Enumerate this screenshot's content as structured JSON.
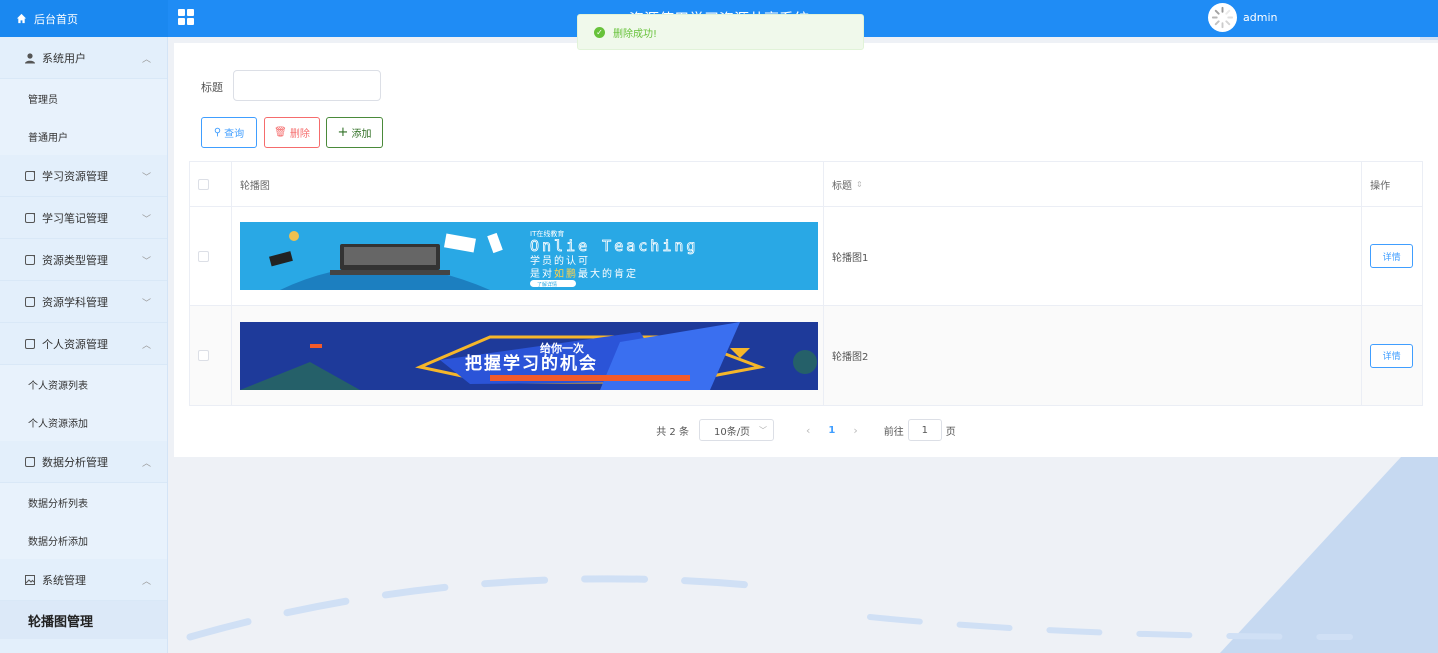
{
  "header": {
    "brand_label": "后台首页",
    "system_title": "资源使用学习资源共享系统",
    "username": "admin"
  },
  "toast": {
    "message": "删除成功!"
  },
  "sidebar": {
    "groups": [
      {
        "label": "系统用户",
        "arrow": "^",
        "icon": "user-icon",
        "items": [
          {
            "label": "管理员"
          },
          {
            "label": "普通用户"
          }
        ]
      },
      {
        "label": "学习资源管理",
        "arrow": "v",
        "icon": "menu-icon"
      },
      {
        "label": "学习笔记管理",
        "arrow": "v",
        "icon": "menu-icon"
      },
      {
        "label": "资源类型管理",
        "arrow": "v",
        "icon": "menu-icon"
      },
      {
        "label": "资源学科管理",
        "arrow": "v",
        "icon": "menu-icon"
      },
      {
        "label": "个人资源管理",
        "arrow": "^",
        "icon": "menu-icon",
        "items": [
          {
            "label": "个人资源列表"
          },
          {
            "label": "个人资源添加"
          }
        ]
      },
      {
        "label": "数据分析管理",
        "arrow": "^",
        "icon": "menu-icon",
        "items": [
          {
            "label": "数据分析列表"
          },
          {
            "label": "数据分析添加"
          }
        ]
      },
      {
        "label": "系统管理",
        "arrow": "^",
        "icon": "image-icon",
        "items": [
          {
            "label": "轮播图管理"
          }
        ]
      }
    ]
  },
  "search": {
    "label": "标题",
    "value": "",
    "placeholder": ""
  },
  "toolbar": {
    "query_label": "查询",
    "delete_label": "删除",
    "add_label": "添加"
  },
  "table": {
    "columns": {
      "image": "轮播图",
      "title": "标题",
      "actions": "操作"
    },
    "rows": [
      {
        "title": "轮播图1",
        "action_label": "详情",
        "banner": {
          "top_text": "IT在线教育",
          "headline": "Onlie Teaching",
          "line1": "学员的认可",
          "line2a": "是对",
          "line2b": "如鹏",
          "line2c": "最大的肯定",
          "pill": "了解详情"
        }
      },
      {
        "title": "轮播图2",
        "action_label": "详情",
        "banner": {
          "line1": "给你一次",
          "line2": "把握学习的机会"
        }
      }
    ]
  },
  "pagination": {
    "total": "共 2 条",
    "page_size": "10条/页",
    "current_page": "1",
    "goto_prefix": "前往",
    "goto_value": "1",
    "goto_suffix": "页"
  },
  "colors": {
    "primary": "#1f8cf5",
    "success": "#67c23a",
    "danger": "#f56c6c",
    "link": "#409eff"
  }
}
